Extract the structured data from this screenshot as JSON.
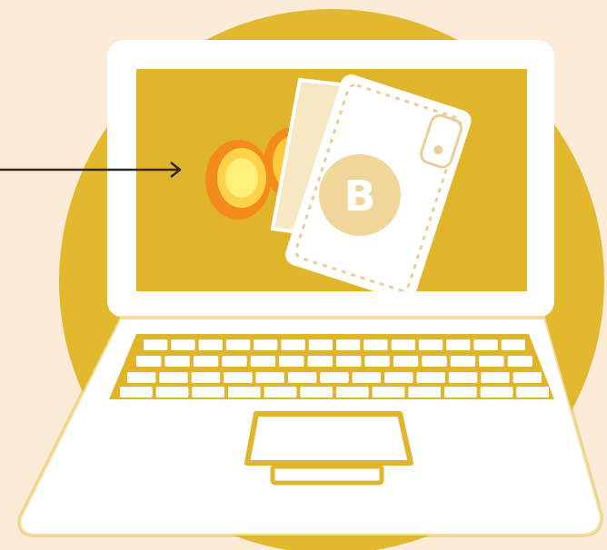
{
  "illustration": {
    "wallet": {
      "badge_letter": "B"
    }
  },
  "colors": {
    "background": "#fcebd7",
    "circle": "#e2b82e",
    "laptop_outline": "#ffffff",
    "screen": "#e0b52c",
    "coin_outer": "#f38a1c",
    "coin_inner": "#fff07a",
    "badge": "#f0d69a",
    "arrow": "#2f2a20"
  },
  "icons": [
    "laptop-icon",
    "wallet-icon",
    "coins-icon",
    "arrow-icon"
  ]
}
